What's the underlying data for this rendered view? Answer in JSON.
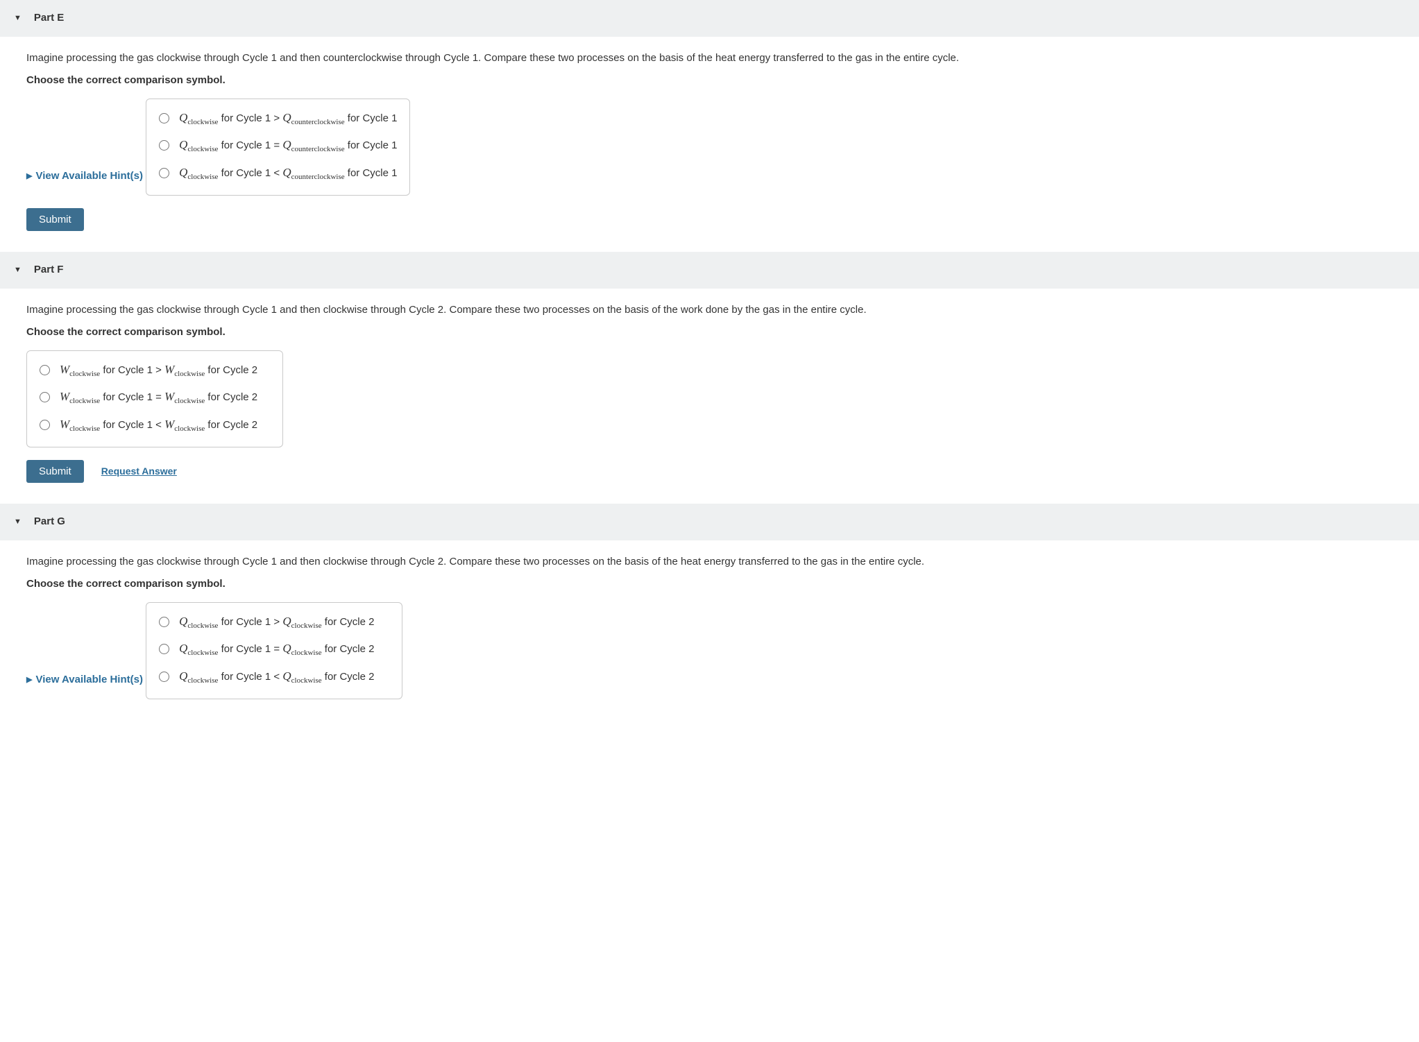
{
  "partE": {
    "title": "Part E",
    "question": "Imagine processing the gas clockwise through Cycle 1 and then counterclockwise through Cycle 1. Compare these two processes on the basis of the heat energy transferred to the gas in the entire cycle.",
    "instruct": "Choose the correct comparison symbol.",
    "hints": "View Available Hint(s)",
    "options": {
      "v1": "Q",
      "s1": "clockwise",
      "t1": " for Cycle 1 > ",
      "v2": "Q",
      "s2": "counterclockwise",
      "t2": " for Cycle 1",
      "v3": "Q",
      "s3": "clockwise",
      "t3": " for Cycle 1 = ",
      "v4": "Q",
      "s4": "counterclockwise",
      "t4": " for Cycle 1",
      "v5": "Q",
      "s5": "clockwise",
      "t5": " for Cycle 1 < ",
      "v6": "Q",
      "s6": "counterclockwise",
      "t6": " for Cycle 1"
    },
    "submit": "Submit"
  },
  "partF": {
    "title": "Part F",
    "question": "Imagine processing the gas clockwise through Cycle 1 and then clockwise through Cycle 2. Compare these two processes on the basis of the work done by the gas in the entire cycle.",
    "instruct": "Choose the correct comparison symbol.",
    "options": {
      "v1": "W",
      "s1": "clockwise",
      "t1": " for Cycle 1 > ",
      "v2": "W",
      "s2": "clockwise",
      "t2": " for Cycle 2",
      "v3": "W",
      "s3": "clockwise",
      "t3": " for Cycle 1 = ",
      "v4": "W",
      "s4": "clockwise",
      "t4": " for Cycle 2",
      "v5": "W",
      "s5": "clockwise",
      "t5": " for Cycle 1 < ",
      "v6": "W",
      "s6": "clockwise",
      "t6": " for Cycle 2"
    },
    "submit": "Submit",
    "request": "Request Answer"
  },
  "partG": {
    "title": "Part G",
    "question": "Imagine processing the gas clockwise through Cycle 1 and then clockwise through Cycle 2. Compare these two processes on the basis of the heat energy transferred to the gas in the entire cycle.",
    "instruct": "Choose the correct comparison symbol.",
    "hints": "View Available Hint(s)",
    "options": {
      "v1": "Q",
      "s1": "clockwise",
      "t1": " for Cycle 1 > ",
      "v2": "Q",
      "s2": "clockwise",
      "t2": " for Cycle 2",
      "v3": "Q",
      "s3": "clockwise",
      "t3": " for Cycle 1 = ",
      "v4": "Q",
      "s4": "clockwise",
      "t4": " for Cycle 2",
      "v5": "Q",
      "s5": "clockwise",
      "t5": " for Cycle 1 < ",
      "v6": "Q",
      "s6": "clockwise",
      "t6": " for Cycle 2"
    }
  }
}
